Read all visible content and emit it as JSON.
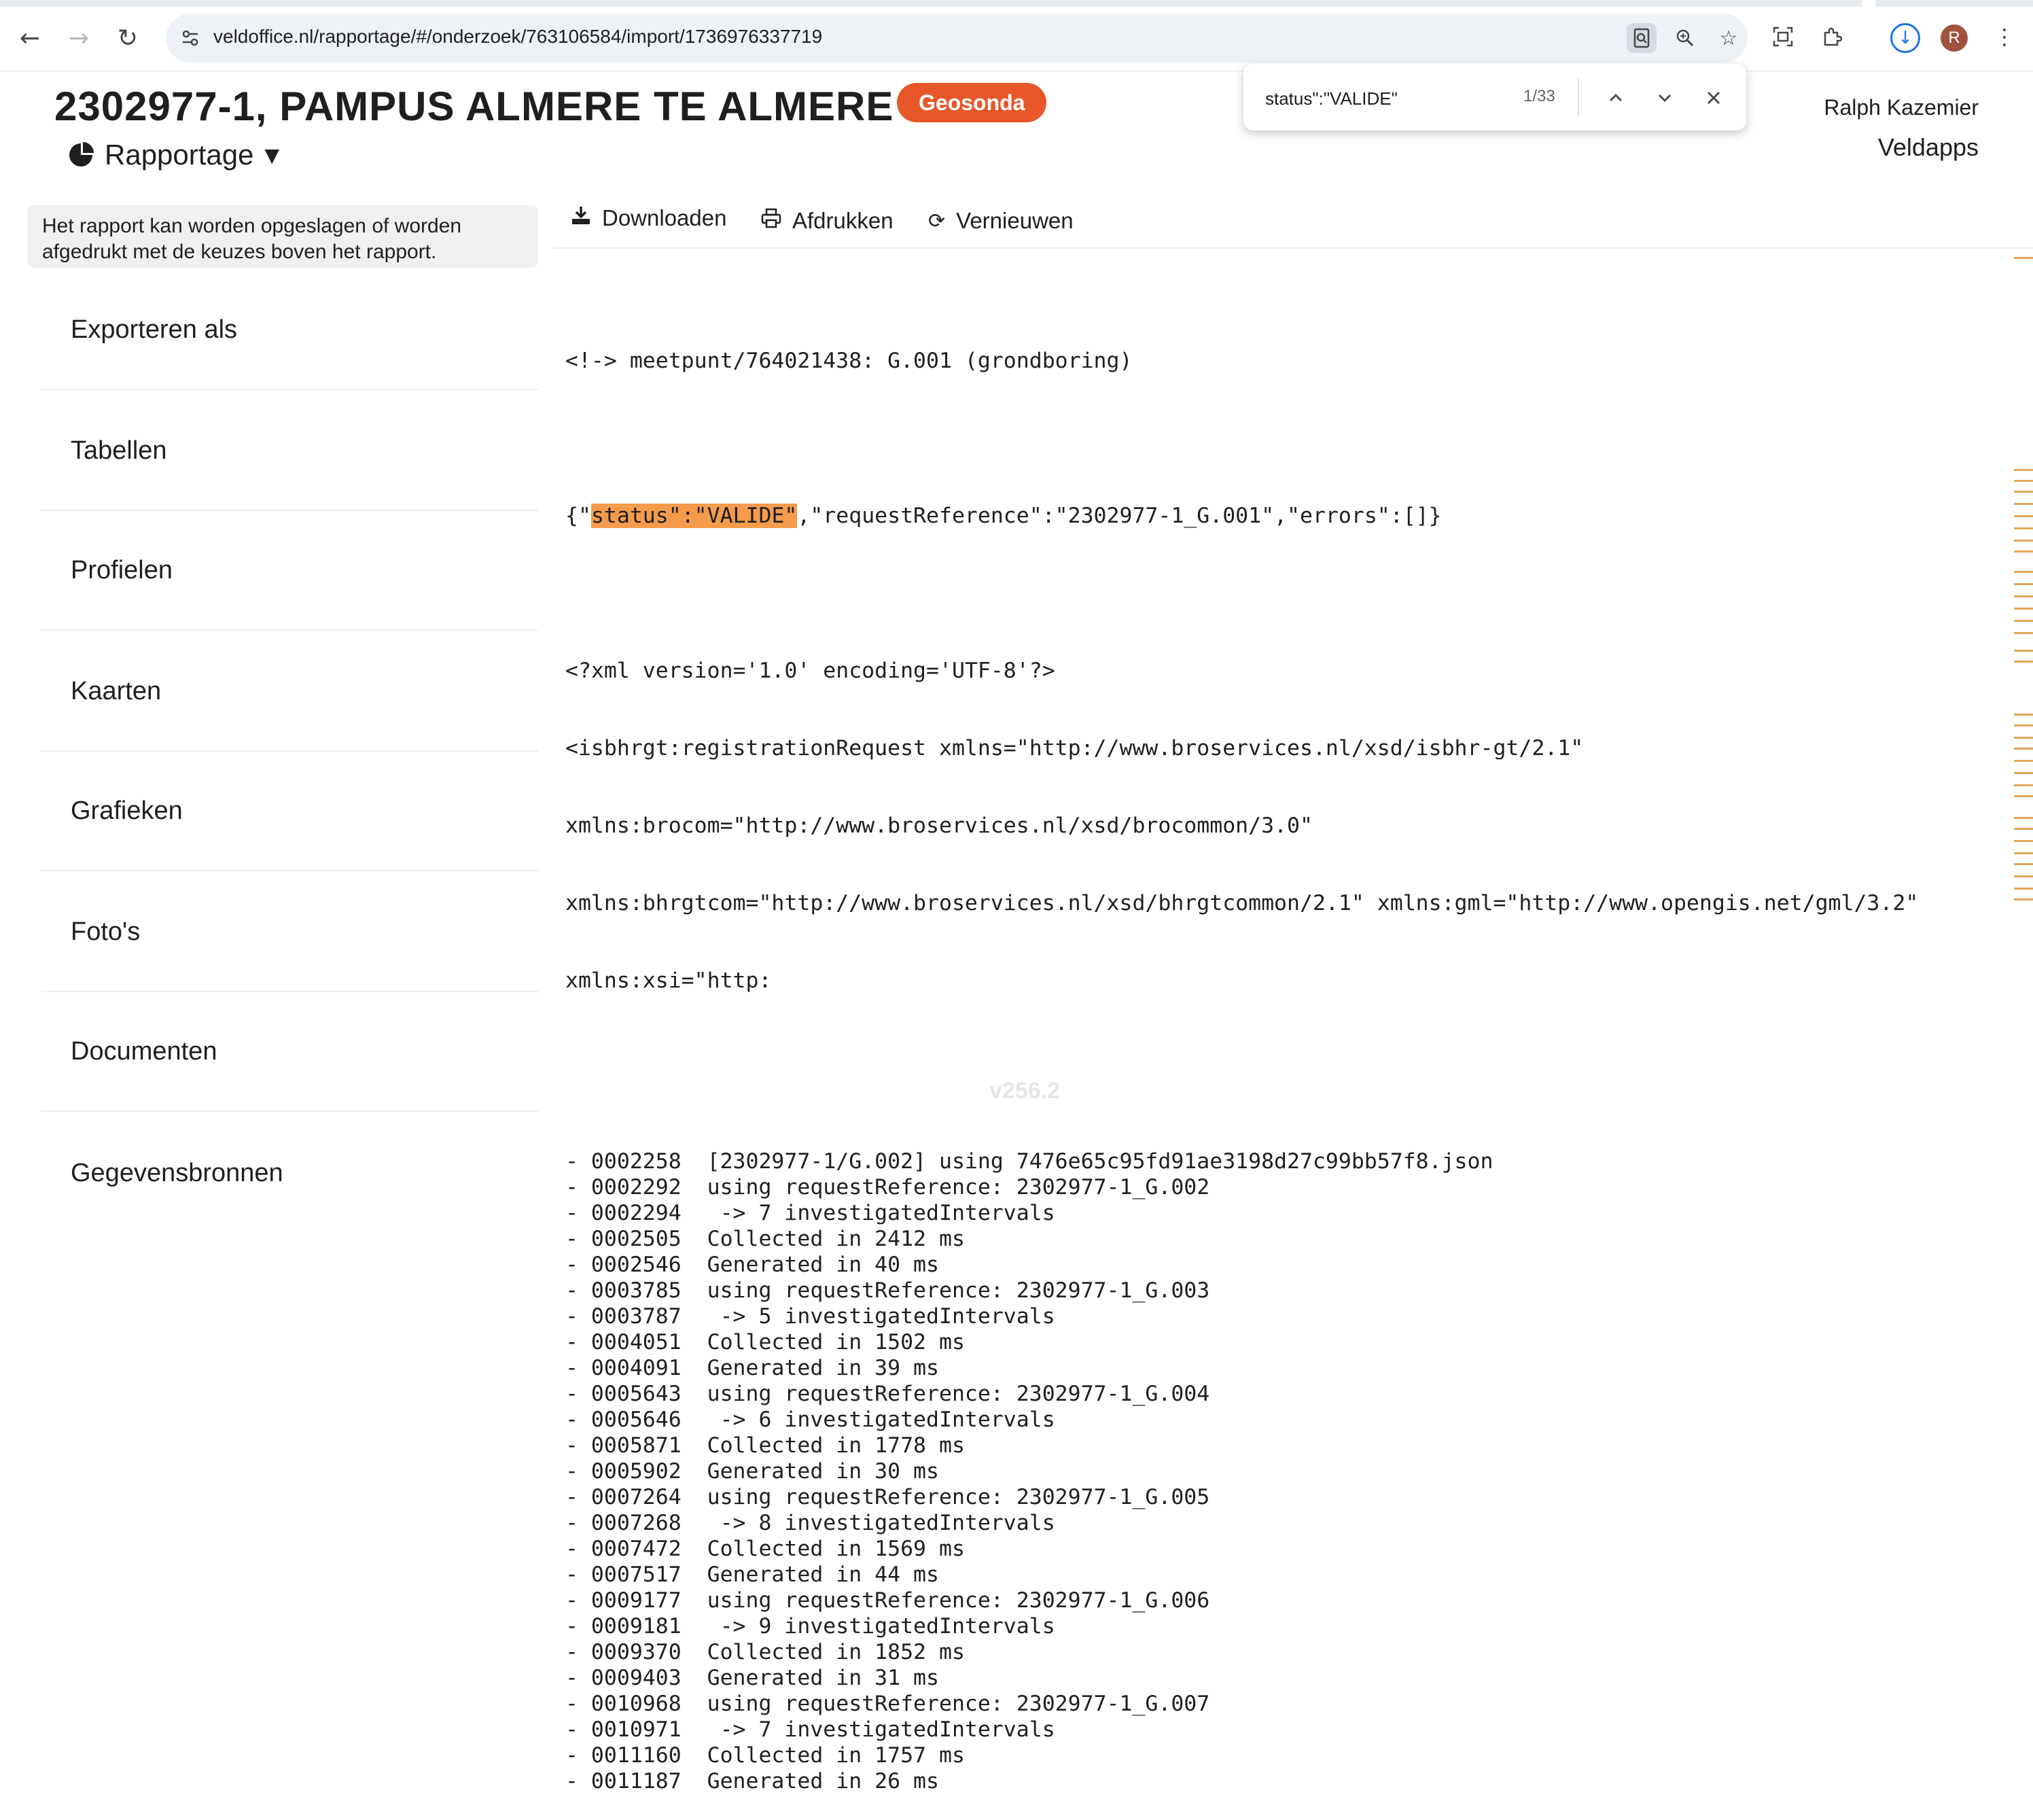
{
  "browser": {
    "url": "veldoffice.nl/rapportage/#/onderzoek/763106584/import/1736976337719",
    "profile_initial": "R"
  },
  "find_bar": {
    "query": "status\":\"VALIDE\"",
    "count": "1/33"
  },
  "header": {
    "title": "2302977-1, PAMPUS ALMERE TE ALMERE",
    "badge": "Geosonda",
    "report_menu_label": "Rapportage",
    "user_name": "Ralph Kazemier",
    "org_name": "Veldapps"
  },
  "sidebar": {
    "note": "Het rapport kan worden opgeslagen of worden afgedrukt met de keuzes boven het rapport.",
    "items": [
      {
        "label": "Exporteren als"
      },
      {
        "label": "Tabellen"
      },
      {
        "label": "Profielen"
      },
      {
        "label": "Kaarten"
      },
      {
        "label": "Grafieken"
      },
      {
        "label": "Foto's"
      },
      {
        "label": "Documenten"
      },
      {
        "label": "Gegevensbronnen"
      }
    ]
  },
  "toolbar": {
    "download_label": "Downloaden",
    "print_label": "Afdrukken",
    "refresh_label": "Vernieuwen"
  },
  "log": {
    "comment_line": "<!-> meetpunt/764021438: G.001 (grondboring)",
    "json_prefix": "{\"",
    "json_highlight": "status\":\"VALIDE\"",
    "json_suffix": ",\"requestReference\":\"2302977-1_G.001\",\"errors\":[]}",
    "xml_lines": [
      "<?xml version='1.0' encoding='UTF-8'?>",
      "<isbhrgt:registrationRequest xmlns=\"http://www.broservices.nl/xsd/isbhr-gt/2.1\"",
      "xmlns:brocom=\"http://www.broservices.nl/xsd/brocommon/3.0\"",
      "xmlns:bhrgtcom=\"http://www.broservices.nl/xsd/bhrgtcommon/2.1\" xmlns:gml=\"http://www.opengis.net/gml/3.2\"",
      "xmlns:xsi=\"http:"
    ],
    "entries": [
      "- 0002258  [2302977-1/G.002] using 7476e65c95fd91ae3198d27c99bb57f8.json",
      "- 0002292  using requestReference: 2302977-1_G.002",
      "- 0002294   -> 7 investigatedIntervals",
      "- 0002505  Collected in 2412 ms",
      "- 0002546  Generated in 40 ms",
      "- 0003785  using requestReference: 2302977-1_G.003",
      "- 0003787   -> 5 investigatedIntervals",
      "- 0004051  Collected in 1502 ms",
      "- 0004091  Generated in 39 ms",
      "- 0005643  using requestReference: 2302977-1_G.004",
      "- 0005646   -> 6 investigatedIntervals",
      "- 0005871  Collected in 1778 ms",
      "- 0005902  Generated in 30 ms",
      "- 0007264  using requestReference: 2302977-1_G.005",
      "- 0007268   -> 8 investigatedIntervals",
      "- 0007472  Collected in 1569 ms",
      "- 0007517  Generated in 44 ms",
      "- 0009177  using requestReference: 2302977-1_G.006",
      "- 0009181   -> 9 investigatedIntervals",
      "- 0009370  Collected in 1852 ms",
      "- 0009403  Generated in 31 ms",
      "- 0010968  using requestReference: 2302977-1_G.007",
      "- 0010971   -> 7 investigatedIntervals",
      "- 0011160  Collected in 1757 ms",
      "- 0011187  Generated in 26 ms"
    ],
    "version_watermark": "v256.2"
  },
  "colors": {
    "badge": "#e8572a",
    "find_highlight": "#f59b4c",
    "scroll_marker": "#e0a85a"
  }
}
